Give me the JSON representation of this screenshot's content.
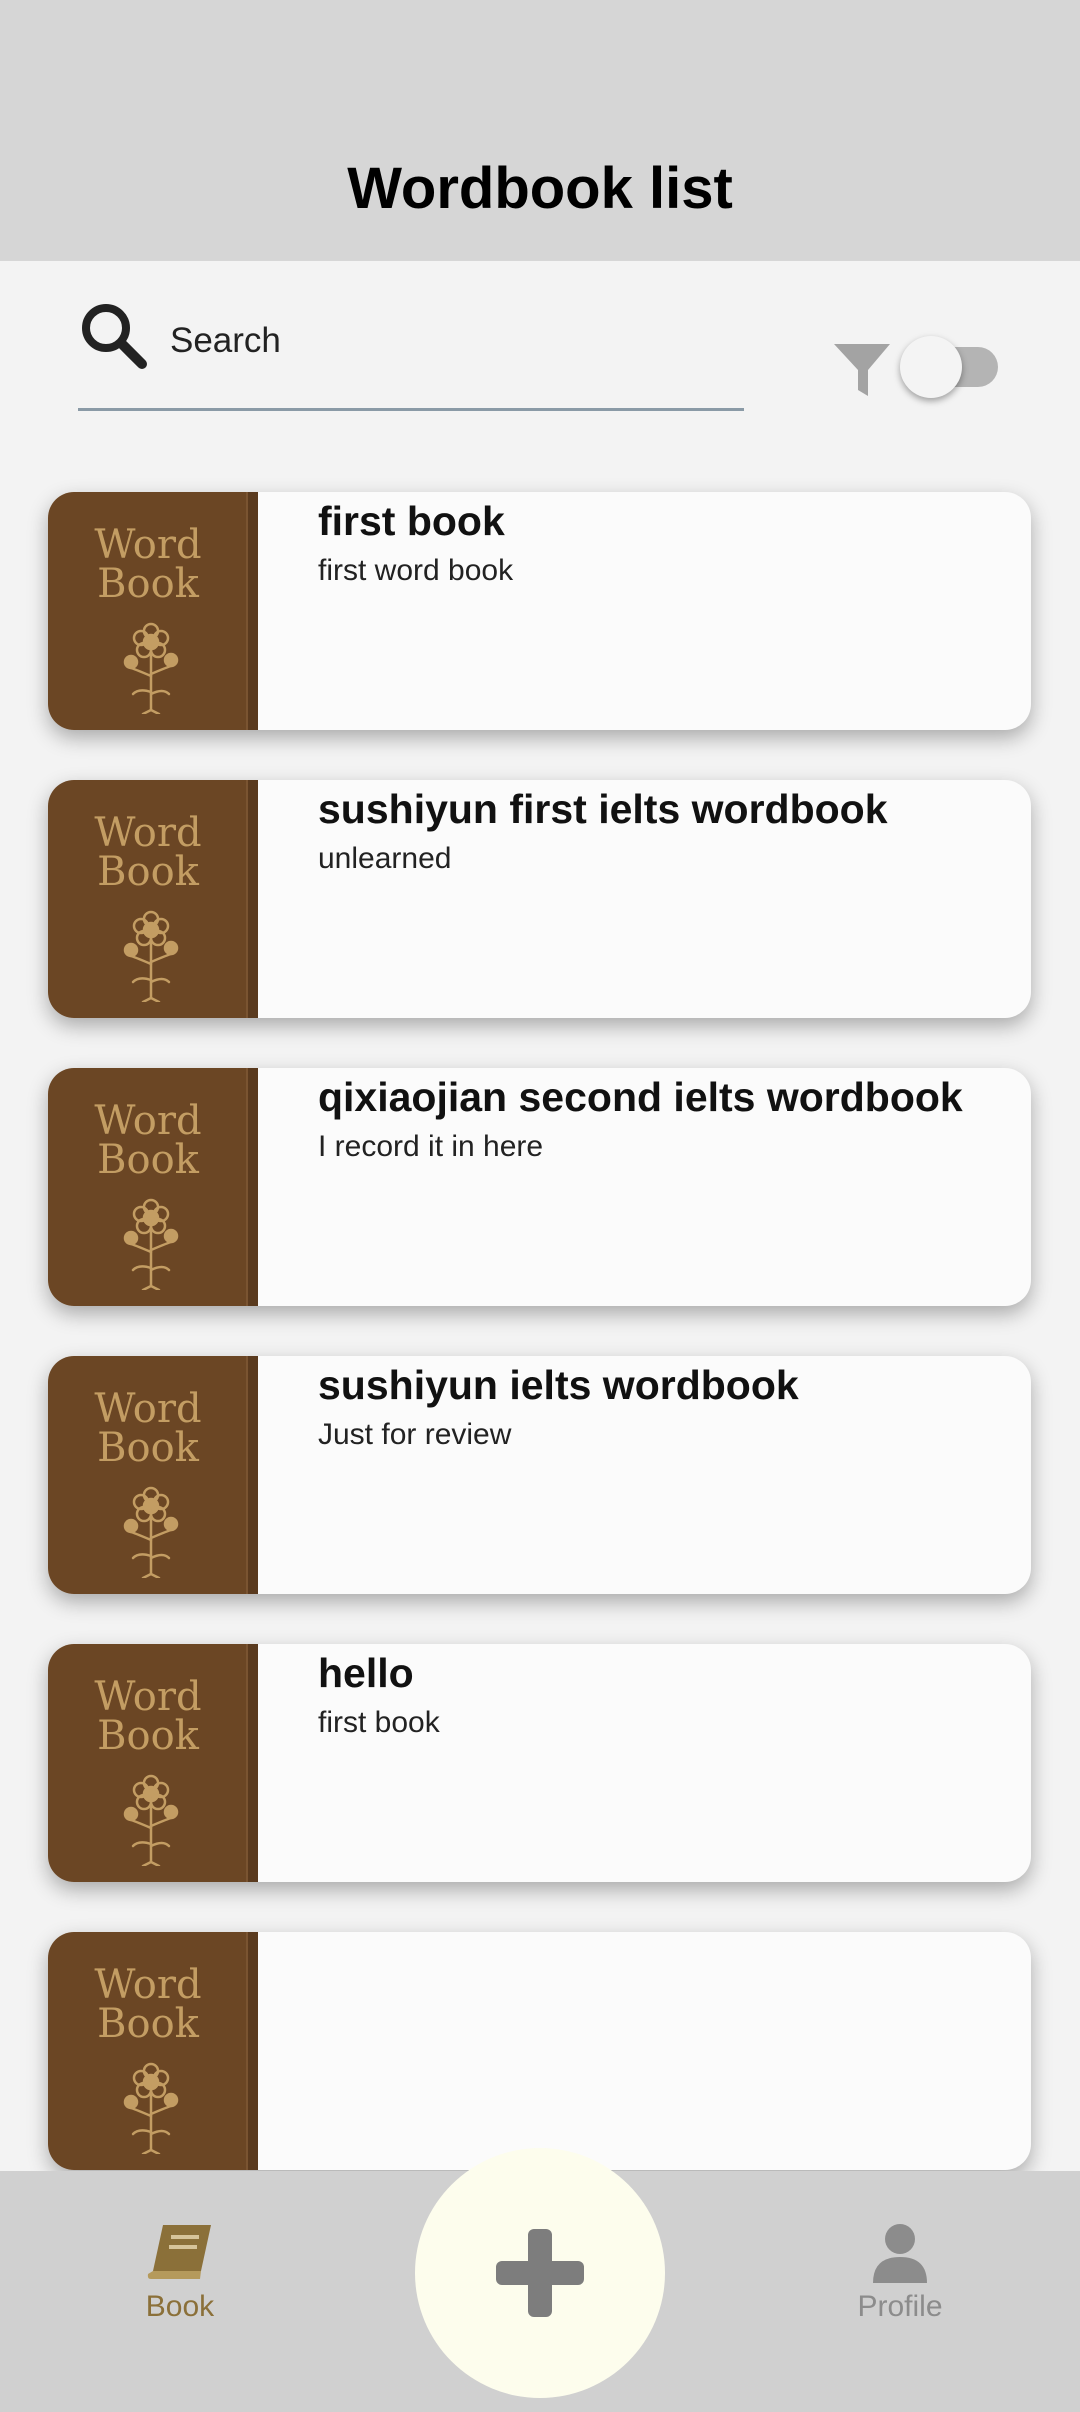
{
  "header": {
    "title": "Wordbook list"
  },
  "search": {
    "placeholder": "Search",
    "value": ""
  },
  "filter": {
    "enabled": false
  },
  "cover": {
    "line1": "Word",
    "line2": "Book"
  },
  "books": [
    {
      "title": "first book",
      "description": "first word book"
    },
    {
      "title": "sushiyun first ielts wordbook",
      "description": "unlearned"
    },
    {
      "title": "qixiaojian second ielts wordbook",
      "description": "I record it in here"
    },
    {
      "title": "sushiyun ielts wordbook",
      "description": "Just for review"
    },
    {
      "title": "hello",
      "description": "first book"
    },
    {
      "title": "",
      "description": ""
    }
  ],
  "nav": {
    "book_label": "Book",
    "profile_label": "Profile",
    "active": "Book"
  },
  "colors": {
    "accent": "#8b7039",
    "cover": "#6b4624",
    "add_button": "#fdfded"
  }
}
